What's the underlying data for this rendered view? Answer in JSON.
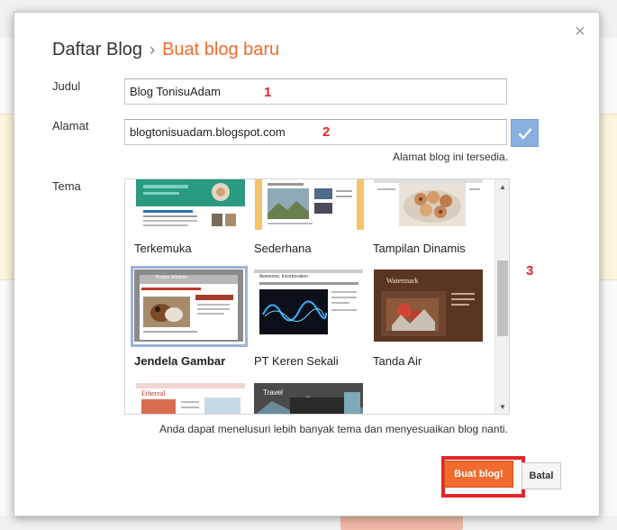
{
  "dialog": {
    "breadcrumb_root": "Daftar Blog",
    "breadcrumb_sep": "›",
    "breadcrumb_current": "Buat blog baru",
    "close_label": "×"
  },
  "form": {
    "title_label": "Judul",
    "title_value": "Blog TonisuAdam",
    "address_label": "Alamat",
    "address_value": "blogtonisuadam.blogspot.com",
    "availability_text": "Alamat blog ini tersedia.",
    "theme_label": "Tema"
  },
  "markers": [
    "1",
    "2",
    "3"
  ],
  "themes": [
    {
      "name": "Terkemuka",
      "selected": false
    },
    {
      "name": "Sederhana",
      "selected": false
    },
    {
      "name": "Tampilan Dinamis",
      "selected": false
    },
    {
      "name": "Jendela Gambar",
      "selected": true
    },
    {
      "name": "PT Keren Sekali",
      "selected": false
    },
    {
      "name": "Tanda Air",
      "selected": false
    }
  ],
  "thumb_text": {
    "jendela": "Picture Window",
    "keren": "Awesome, Incorporation",
    "watermark": "Watermark",
    "ethereal": "Ethereal",
    "travel": "Travel"
  },
  "hint": "Anda dapat menelusuri lebih banyak tema dan menyesuaikan blog nanti.",
  "buttons": {
    "create": "Buat blog!",
    "cancel": "Batal"
  },
  "colors": {
    "accent": "#f06b2d",
    "highlight": "#e3262a",
    "check_button": "#8ab0e0",
    "selected_frame": "#9cb3d7"
  }
}
